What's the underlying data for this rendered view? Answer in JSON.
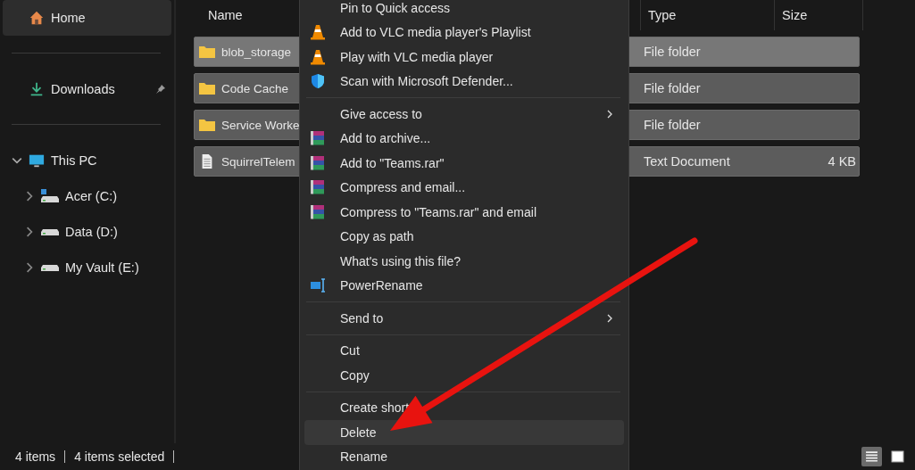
{
  "sidebar": {
    "sections": [
      {
        "items": [
          {
            "label": "Home",
            "kind": "home",
            "selected": true,
            "pinned": false
          }
        ]
      },
      {
        "items": [
          {
            "label": "Downloads",
            "kind": "downloads",
            "selected": false,
            "pinned": true
          }
        ]
      },
      {
        "items": [
          {
            "label": "This PC",
            "kind": "pc",
            "selected": false,
            "pinned": false,
            "expanded": true,
            "children": [
              {
                "label": "Acer (C:)",
                "kind": "system-drive",
                "expanded": false
              },
              {
                "label": "Data (D:)",
                "kind": "drive",
                "expanded": false
              },
              {
                "label": "My Vault (E:)",
                "kind": "drive",
                "expanded": false
              }
            ]
          }
        ]
      }
    ]
  },
  "file_list": {
    "columns": [
      "Name",
      "Type",
      "Size"
    ],
    "rows": [
      {
        "name": "blob_storage",
        "kind": "folder",
        "type": "File folder",
        "size": "",
        "selected": true,
        "hovered": true
      },
      {
        "name": "Code Cache",
        "kind": "folder",
        "type": "File folder",
        "size": "",
        "selected": true,
        "hovered": false
      },
      {
        "name": "Service Worke",
        "kind": "folder",
        "type": "File folder",
        "size": "",
        "selected": true,
        "hovered": false
      },
      {
        "name": "SquirrelTelem",
        "kind": "text",
        "type": "Text Document",
        "size": "4 KB",
        "selected": true,
        "hovered": false
      }
    ]
  },
  "context_menu": {
    "groups": [
      [
        {
          "label": "Pin to Quick access",
          "kind": "plain",
          "submenu": false,
          "hovered": false
        },
        {
          "label": "Add to VLC media player's Playlist",
          "kind": "vlc",
          "submenu": false,
          "hovered": false
        },
        {
          "label": "Play with VLC media player",
          "kind": "vlc",
          "submenu": false,
          "hovered": false
        },
        {
          "label": "Scan with Microsoft Defender...",
          "kind": "shield",
          "submenu": false,
          "hovered": false
        }
      ],
      [
        {
          "label": "Give access to",
          "kind": "plain",
          "submenu": true,
          "hovered": false
        },
        {
          "label": "Add to archive...",
          "kind": "archive",
          "submenu": false,
          "hovered": false
        },
        {
          "label": "Add to \"Teams.rar\"",
          "kind": "archive",
          "submenu": false,
          "hovered": false
        },
        {
          "label": "Compress and email...",
          "kind": "archive",
          "submenu": false,
          "hovered": false
        },
        {
          "label": "Compress to \"Teams.rar\" and email",
          "kind": "archive",
          "submenu": false,
          "hovered": false
        },
        {
          "label": "Copy as path",
          "kind": "plain",
          "submenu": false,
          "hovered": false
        },
        {
          "label": "What's using this file?",
          "kind": "plain",
          "submenu": false,
          "hovered": false
        },
        {
          "label": "PowerRename",
          "kind": "rename",
          "submenu": false,
          "hovered": false
        }
      ],
      [
        {
          "label": "Send to",
          "kind": "plain",
          "submenu": true,
          "hovered": false
        }
      ],
      [
        {
          "label": "Cut",
          "kind": "plain",
          "submenu": false,
          "hovered": false
        },
        {
          "label": "Copy",
          "kind": "plain",
          "submenu": false,
          "hovered": false
        }
      ],
      [
        {
          "label": "Create short",
          "kind": "plain",
          "submenu": false,
          "hovered": false
        },
        {
          "label": "Delete",
          "kind": "plain",
          "submenu": false,
          "hovered": true
        },
        {
          "label": "Rename",
          "kind": "plain",
          "submenu": false,
          "hovered": false
        }
      ]
    ]
  },
  "status_bar": {
    "item_count": "4 items",
    "selection": "4 items selected",
    "views": [
      {
        "kind": "details",
        "selected": true
      },
      {
        "kind": "tiles",
        "selected": false
      }
    ]
  }
}
